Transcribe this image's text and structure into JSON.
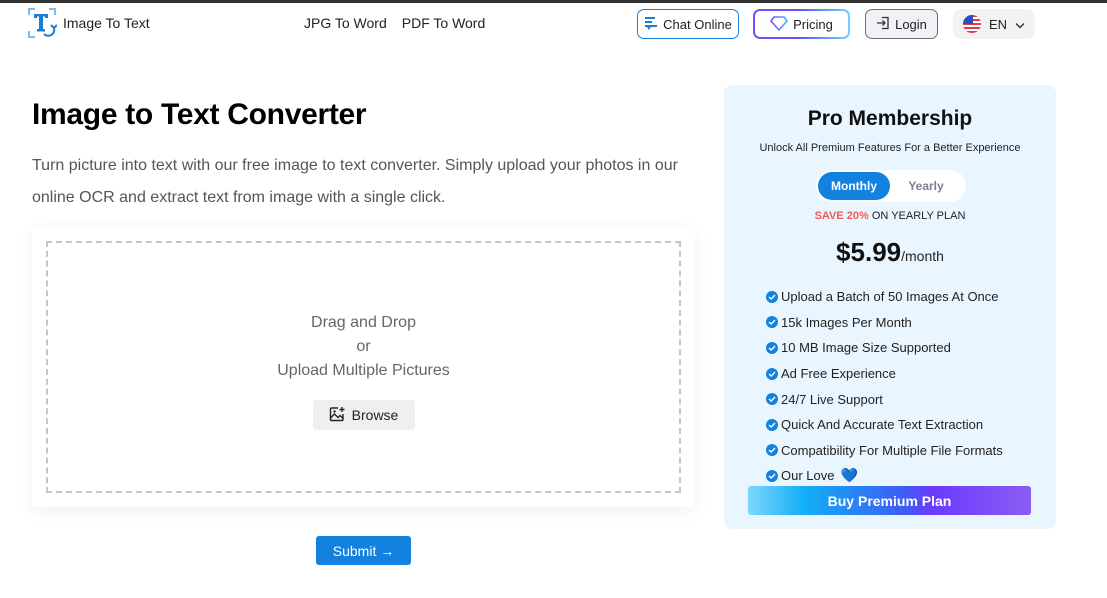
{
  "header": {
    "logo_text": "Image To Text",
    "nav": [
      {
        "label": "JPG To Word"
      },
      {
        "label": "PDF To Word"
      }
    ],
    "chat_label": "Chat Online",
    "pricing_label": "Pricing",
    "login_label": "Login",
    "language": "EN"
  },
  "main": {
    "title": "Image to Text Converter",
    "description": "Turn picture into text with our free image to text converter. Simply upload your photos in our online OCR and extract text from image with a single click.",
    "upload": {
      "line1": "Drag and Drop",
      "line2": "or",
      "line3": "Upload Multiple Pictures",
      "browse_label": "Browse"
    },
    "submit_label": "Submit →"
  },
  "pro": {
    "title": "Pro Membership",
    "subtitle": "Unlock All Premium Features For a Better Experience",
    "toggle": {
      "monthly": "Monthly",
      "yearly": "Yearly",
      "selected": "Monthly"
    },
    "save_highlight": "SAVE 20%",
    "save_rest": "ON YEARLY PLAN",
    "price": "$5.99",
    "period": "/month",
    "features": [
      "Upload a Batch of 50 Images At Once",
      "15k Images Per Month",
      "10 MB Image Size Supported",
      "Ad Free Experience",
      "24/7 Live Support",
      "Quick And Accurate Text Extraction",
      "Compatibility For Multiple File Formats",
      "Our Love"
    ],
    "buy_label": "Buy Premium Plan"
  },
  "colors": {
    "accent": "#1381e0",
    "save_red": "#f25a5a",
    "card_bg": "#eaf6ff"
  }
}
